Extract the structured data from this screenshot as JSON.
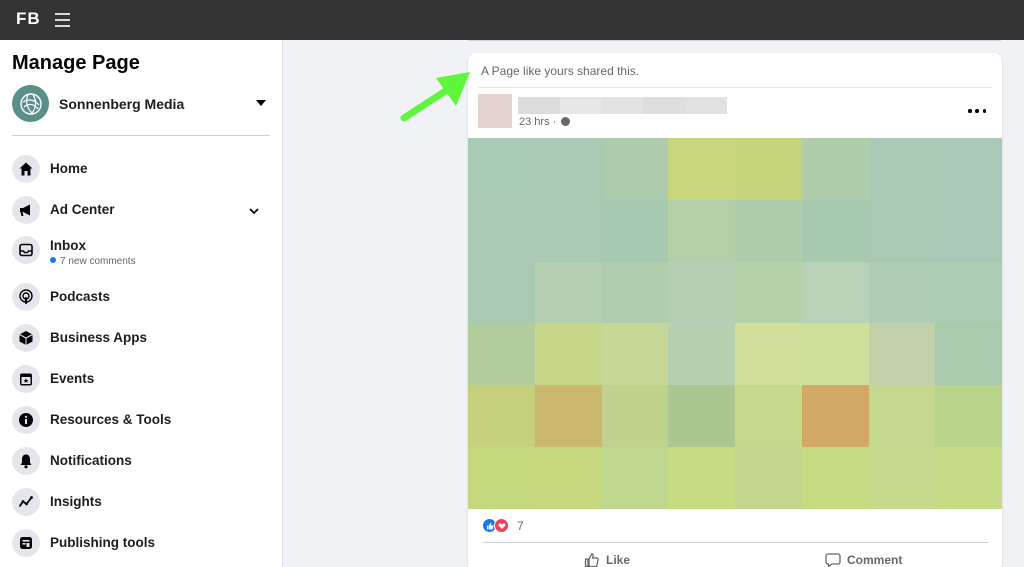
{
  "topbar": {
    "logo": "FB",
    "menu_icon": "hamburger-icon"
  },
  "sidebar": {
    "title": "Manage Page",
    "page_name": "Sonnenberg Media",
    "items": [
      {
        "label": "Home",
        "icon": "home-icon"
      },
      {
        "label": "Ad Center",
        "icon": "megaphone-icon",
        "expandable": true
      },
      {
        "label": "Inbox",
        "icon": "inbox-icon",
        "sub": "7 new comments"
      },
      {
        "label": "Podcasts",
        "icon": "podcast-icon"
      },
      {
        "label": "Business Apps",
        "icon": "box-icon"
      },
      {
        "label": "Events",
        "icon": "calendar-icon"
      },
      {
        "label": "Resources & Tools",
        "icon": "info-icon"
      },
      {
        "label": "Notifications",
        "icon": "bell-icon"
      },
      {
        "label": "Insights",
        "icon": "trend-icon"
      },
      {
        "label": "Publishing tools",
        "icon": "publishing-icon"
      }
    ]
  },
  "post": {
    "shared_note": "A Page like yours shared this.",
    "time": "23 hrs ·",
    "reaction_count": "7",
    "like_label": "Like",
    "comment_label": "Comment",
    "name_redact_colors": [
      "#dcdcdc",
      "#e6e6e6",
      "#e3e3e3",
      "#dedede",
      "#e1e1e1"
    ],
    "image_tiles": [
      "#a8c9b3",
      "#a9c9b3",
      "#adcbad",
      "#c8d57c",
      "#c6d57c",
      "#afcdab",
      "#a9c9b5",
      "#a9c9b6",
      "#a9c9b3",
      "#a9c9b3",
      "#a8c9b1",
      "#b2cfa8",
      "#aecdaa",
      "#a7c9b0",
      "#a9c9b5",
      "#a9c9b6",
      "#a9c9b3",
      "#b5d0b1",
      "#b0cdae",
      "#b4cfb3",
      "#b6d2ab",
      "#b8d2b8",
      "#aecdb4",
      "#aecdb5",
      "#b2cc9b",
      "#c6d789",
      "#c5d898",
      "#b7d1b0",
      "#d0e09b",
      "#cfe09a",
      "#c1d0a8",
      "#aacaae",
      "#c6d07a",
      "#cbb76e",
      "#bfd38d",
      "#abc690",
      "#c5d98d",
      "#d1a865",
      "#c4d88e",
      "#b9d38a",
      "#c3d87d",
      "#c5d87e",
      "#bed68f",
      "#c7db83",
      "#c1d68c",
      "#c6db81",
      "#c5d98d",
      "#c6db86"
    ]
  },
  "colors": {
    "accent_arrow": "#5ef53c",
    "brand_blue": "#1877f2",
    "love_red": "#f33e58",
    "topbar": "#333333"
  }
}
